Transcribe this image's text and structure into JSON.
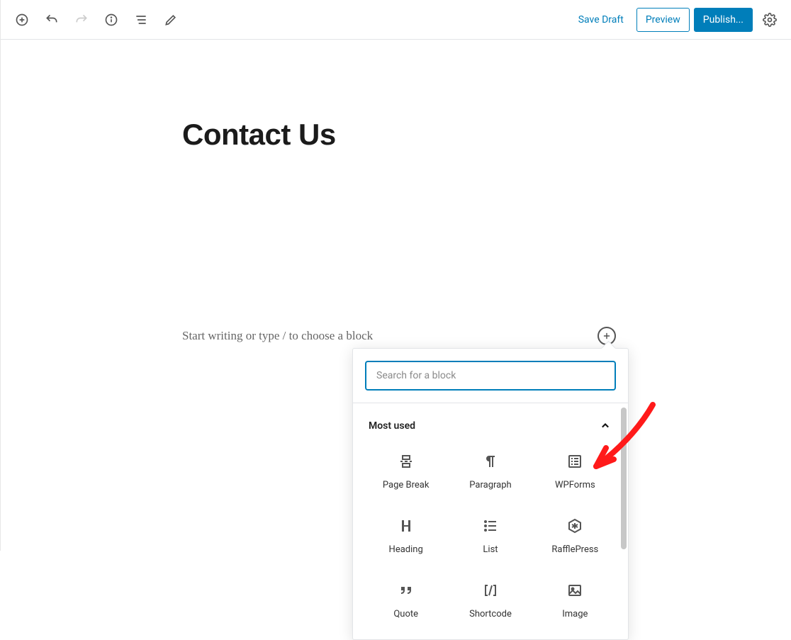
{
  "toolbar": {
    "save_draft": "Save Draft",
    "preview": "Preview",
    "publish": "Publish..."
  },
  "editor": {
    "title": "Contact Us",
    "placeholder": "Start writing or type / to choose a block"
  },
  "block_picker": {
    "search_placeholder": "Search for a block",
    "section_title": "Most used",
    "blocks": [
      {
        "label": "Page Break",
        "icon": "page-break-icon"
      },
      {
        "label": "Paragraph",
        "icon": "paragraph-icon"
      },
      {
        "label": "WPForms",
        "icon": "wpforms-icon"
      },
      {
        "label": "Heading",
        "icon": "heading-icon"
      },
      {
        "label": "List",
        "icon": "list-icon"
      },
      {
        "label": "RafflePress",
        "icon": "rafflepress-icon"
      },
      {
        "label": "Quote",
        "icon": "quote-icon"
      },
      {
        "label": "Shortcode",
        "icon": "shortcode-icon"
      },
      {
        "label": "Image",
        "icon": "image-icon"
      }
    ]
  }
}
